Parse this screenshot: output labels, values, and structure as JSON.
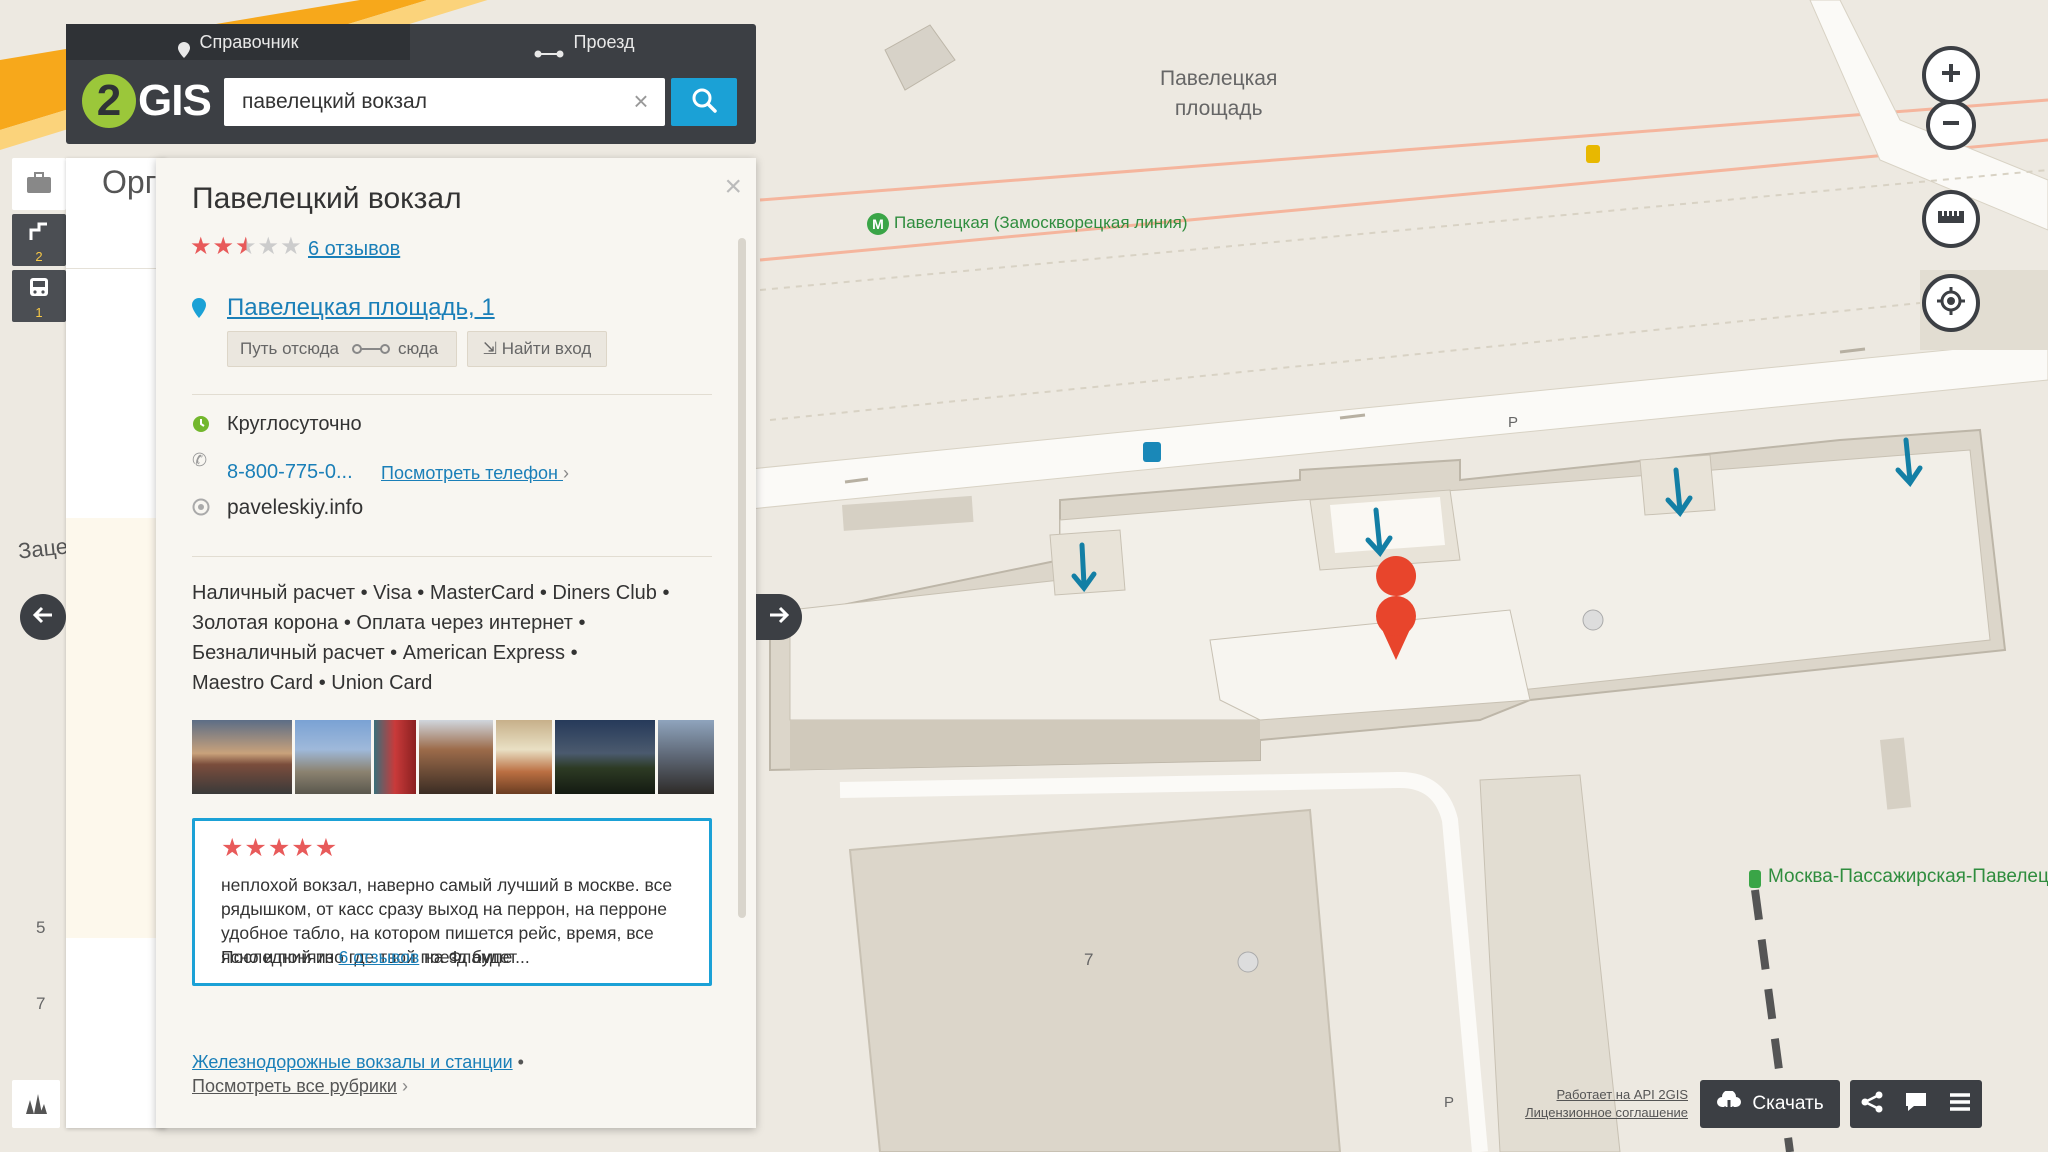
{
  "header": {
    "tabs": [
      {
        "label": "Справочник",
        "icon": "pin-icon"
      },
      {
        "label": "Проезд",
        "icon": "route-icon"
      }
    ],
    "logo_text": "GIS",
    "logo_num": "2",
    "search_value": "павелецкий вокзал"
  },
  "sidebar": {
    "badges": [
      "2",
      "1"
    ],
    "list_header": "Орга"
  },
  "card": {
    "title": "Павелецкий вокзал",
    "rating": 2.5,
    "reviews_link": "6 отзывов",
    "address": "Павелецкая площадь, 1",
    "route_from": "Путь отсюда",
    "route_to": "сюда",
    "find_entrance": "Найти вход",
    "hours": "Круглосуточно",
    "phone": "8-800-775-0...",
    "show_phone": "Посмотреть телефон",
    "website": "paveleskiy.info",
    "payments": [
      "Наличный расчет • Visa • MasterCard • Diners Club •",
      "Золотая корона • Оплата через интернет •",
      "Безналичный расчет • American Express •",
      "Maestro Card • Union Card"
    ],
    "review": {
      "stars": 5,
      "text": [
        "неплохой вокзал, наверно самый лучший в москве. все",
        "рядышком, от касс сразу выход на перрон, на перроне",
        "удобное табло, на котором пишется рейс, время, все",
        "ясно и понятно где твой поезд будет..."
      ],
      "footer_prefix": "Последний из",
      "footer_link": "6 отзывов",
      "footer_suffix": "на Флампе"
    },
    "category_link": "Железнодорожные вокзалы и станции",
    "all_categories": "Посмотреть все рубрики"
  },
  "map": {
    "square_label_1": "Павелецкая",
    "square_label_2": "площадь",
    "metro_label": "Павелецкая (Замоскворецкая линия)",
    "station_label": "Москва-Пассажирская-Павелец",
    "street_label": "Заце",
    "building_number": "7",
    "left_numbers": [
      "5",
      "7"
    ],
    "parking": "P",
    "attribution_1": "Работает на API 2GIS",
    "attribution_2": "Лицензионное соглашение"
  },
  "bottom": {
    "download": "Скачать"
  },
  "colors": {
    "accent": "#1ba1d6",
    "dark": "#3c3f44",
    "pin": "#e8452c",
    "metro": "#3aa547",
    "star": "#e85a5a"
  }
}
